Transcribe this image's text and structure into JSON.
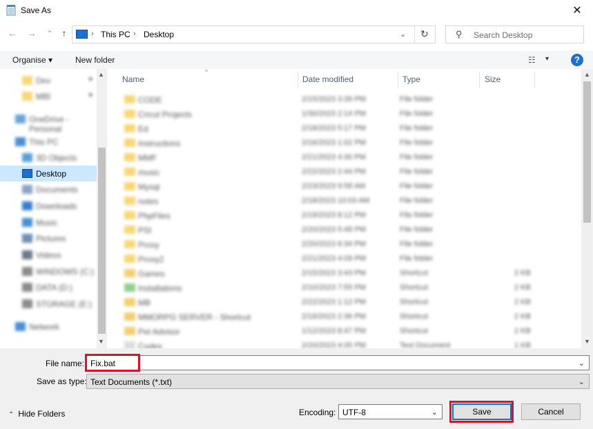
{
  "window": {
    "title": "Save As",
    "close_glyph": "✕"
  },
  "address": {
    "back_glyph": "←",
    "forward_glyph": "→",
    "recent_glyph": "⌄",
    "up_glyph": "↑",
    "crumbs": [
      "This PC",
      "Desktop"
    ],
    "sep_glyph": "›",
    "dropdown_glyph": "⌄",
    "refresh_glyph": "↻"
  },
  "search": {
    "placeholder": "Search Desktop",
    "icon": "search-icon",
    "glyph": "⚲"
  },
  "toolbar": {
    "organise": "Organise ▾",
    "new_folder": "New folder",
    "view_glyph": "☷",
    "view_drop": "▾",
    "help": "?"
  },
  "nav": {
    "items": [
      {
        "label": "Dev",
        "icon": "folder"
      },
      {
        "label": "MBI",
        "icon": "folder"
      },
      {
        "label": "OneDrive - Personal",
        "icon": "cloud"
      },
      {
        "label": "This PC",
        "icon": "pc"
      },
      {
        "label": "3D Objects",
        "icon": "cube"
      },
      {
        "label": "Desktop",
        "icon": "desktop",
        "selected": true
      },
      {
        "label": "Documents",
        "icon": "doc"
      },
      {
        "label": "Downloads",
        "icon": "download"
      },
      {
        "label": "Music",
        "icon": "music"
      },
      {
        "label": "Pictures",
        "icon": "pictures"
      },
      {
        "label": "Videos",
        "icon": "video"
      },
      {
        "label": "WINDOWS (C:)",
        "icon": "drive"
      },
      {
        "label": "DATA (D:)",
        "icon": "drive"
      },
      {
        "label": "STORAGE (E:)",
        "icon": "drive"
      },
      {
        "label": "Network",
        "icon": "network"
      }
    ],
    "up_arrow": "▲",
    "down_arrow": "▼"
  },
  "columns": {
    "name": "Name",
    "date": "Date modified",
    "type": "Type",
    "size": "Size",
    "sort_glyph": "^"
  },
  "files": [
    {
      "name": "CODE",
      "date": "2/15/2023 3:39 PM",
      "type": "File folder",
      "size": "",
      "icon": "folder"
    },
    {
      "name": "Cricut Projects",
      "date": "1/30/2023 2:14 PM",
      "type": "File folder",
      "size": "",
      "icon": "folder"
    },
    {
      "name": "Ed",
      "date": "2/18/2023 5:17 PM",
      "type": "File folder",
      "size": "",
      "icon": "folder"
    },
    {
      "name": "Instructions",
      "date": "2/16/2023 1:02 PM",
      "type": "File folder",
      "size": "",
      "icon": "folder"
    },
    {
      "name": "MMF",
      "date": "2/21/2023 4:30 PM",
      "type": "File folder",
      "size": "",
      "icon": "folder"
    },
    {
      "name": "music",
      "date": "2/22/2023 2:44 PM",
      "type": "File folder",
      "size": "",
      "icon": "folder"
    },
    {
      "name": "Mysql",
      "date": "2/23/2023 9:58 AM",
      "type": "File folder",
      "size": "",
      "icon": "folder"
    },
    {
      "name": "notes",
      "date": "2/18/2023 10:03 AM",
      "type": "File folder",
      "size": "",
      "icon": "folder"
    },
    {
      "name": "PhpFiles",
      "date": "2/19/2023 8:12 PM",
      "type": "File folder",
      "size": "",
      "icon": "folder"
    },
    {
      "name": "PSI",
      "date": "2/20/2023 5:48 PM",
      "type": "File folder",
      "size": "",
      "icon": "folder"
    },
    {
      "name": "Proxy",
      "date": "2/20/2023 6:34 PM",
      "type": "File folder",
      "size": "",
      "icon": "folder"
    },
    {
      "name": "Proxy2",
      "date": "2/21/2023 4:09 PM",
      "type": "File folder",
      "size": "",
      "icon": "folder"
    },
    {
      "name": "Games",
      "date": "2/15/2023 3:43 PM",
      "type": "Shortcut",
      "size": "2 KB",
      "icon": "shortcut"
    },
    {
      "name": "Installations",
      "date": "2/10/2023 7:55 PM",
      "type": "Shortcut",
      "size": "2 KB",
      "icon": "shortcut-green"
    },
    {
      "name": "MB",
      "date": "2/22/2023 1:12 PM",
      "type": "Shortcut",
      "size": "2 KB",
      "icon": "shortcut"
    },
    {
      "name": "MMORPG SERVER - Shortcut",
      "date": "2/16/2023 2:36 PM",
      "type": "Shortcut",
      "size": "2 KB",
      "icon": "shortcut"
    },
    {
      "name": "Pet Advisor",
      "date": "1/12/2023 8:47 PM",
      "type": "Shortcut",
      "size": "2 KB",
      "icon": "shortcut"
    },
    {
      "name": "Codes",
      "date": "2/20/2023 4:05 PM",
      "type": "Text Document",
      "size": "1 KB",
      "icon": "text"
    }
  ],
  "form": {
    "file_name_label": "File name:",
    "file_name_value": "Fix.bat",
    "save_type_label": "Save as type:",
    "save_type_value": "Text Documents (*.txt)",
    "encoding_label": "Encoding:",
    "encoding_value": "UTF-8",
    "save": "Save",
    "cancel": "Cancel",
    "hide_folders": "Hide Folders",
    "hide_chevron": "⌃",
    "drop_glyph": "⌄"
  },
  "colors": {
    "accent": "#0078d7",
    "highlight": "#e0102a",
    "selected": "#cce8ff",
    "folder": "#f8d775"
  }
}
